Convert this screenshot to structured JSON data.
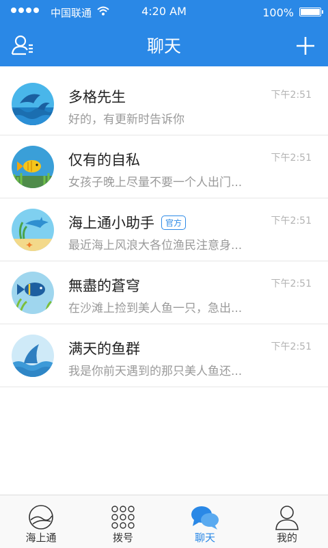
{
  "status_bar": {
    "carrier": "中国联通",
    "time": "4:20 AM",
    "battery": "100%"
  },
  "header": {
    "title": "聊天",
    "left_icon": "contacts-icon",
    "right_icon": "plus-icon"
  },
  "chats": [
    {
      "name": "多格先生",
      "preview": "好的，有更新时告诉你",
      "time": "下午2:51",
      "avatar": "dolphins-icon",
      "official": ""
    },
    {
      "name": "仅有的自私",
      "preview": "女孩子晚上尽量不要一个人出门...",
      "time": "下午2:51",
      "avatar": "yellow-fish-icon",
      "official": ""
    },
    {
      "name": "海上通小助手",
      "preview": "最近海上风浪大各位渔民注意身...",
      "time": "下午2:51",
      "avatar": "dolphin-icon",
      "official": "官方"
    },
    {
      "name": "無盡的蒼穹",
      "preview": "在沙滩上捡到美人鱼一只，急出...",
      "time": "下午2:51",
      "avatar": "blue-fish-icon",
      "official": ""
    },
    {
      "name": "满天的鱼群",
      "preview": "我是你前天遇到的那只美人鱼还...",
      "time": "下午2:51",
      "avatar": "shark-fin-icon",
      "official": ""
    }
  ],
  "tabs": [
    {
      "label": "海上通",
      "icon": "globe-icon",
      "active": false
    },
    {
      "label": "拨号",
      "icon": "dialpad-icon",
      "active": false
    },
    {
      "label": "聊天",
      "icon": "chat-bubbles-icon",
      "active": true
    },
    {
      "label": "我的",
      "icon": "person-icon",
      "active": false
    }
  ],
  "colors": {
    "accent": "#2a88e6",
    "background": "#ffffff",
    "preview_text": "#9a9a9a",
    "divider": "#e6e6e6"
  }
}
